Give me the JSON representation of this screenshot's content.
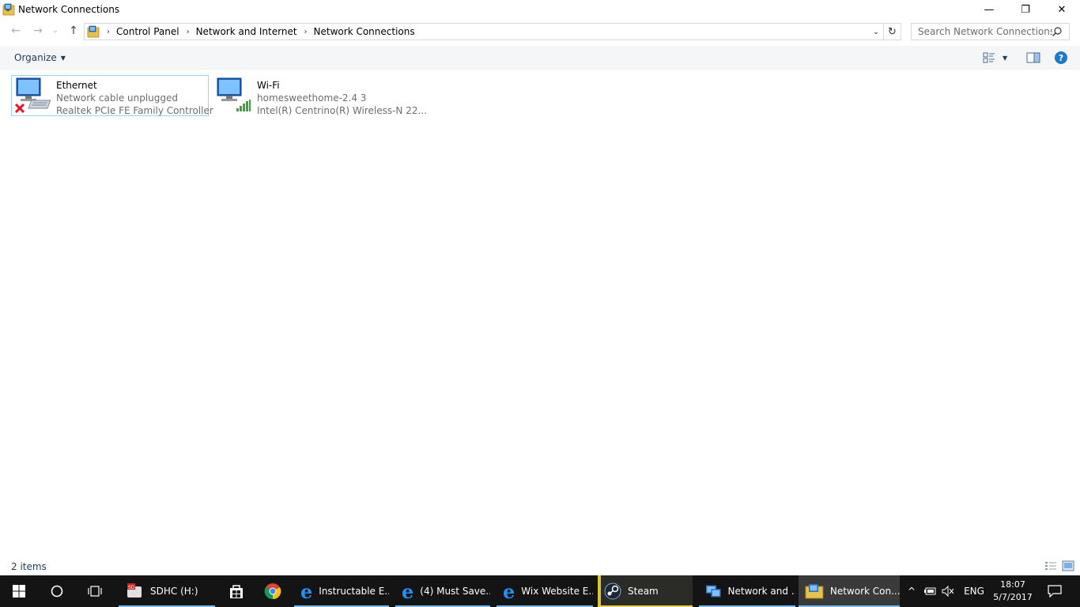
{
  "window": {
    "title": "Network Connections",
    "controls": {
      "minimize": "—",
      "maximize": "❐",
      "close": "✕"
    }
  },
  "nav": {
    "back": "←",
    "forward": "→",
    "recent": "⌄",
    "up": "↑",
    "breadcrumb": [
      "Control Panel",
      "Network and Internet",
      "Network Connections"
    ],
    "separator": "›",
    "dropdown": "⌄",
    "refresh": "↻"
  },
  "search": {
    "placeholder": "Search Network Connections"
  },
  "commandbar": {
    "organize_label": "Organize",
    "organize_arrow": "▼",
    "view_arrow": "▼",
    "help": "?"
  },
  "items": [
    {
      "name": "Ethernet",
      "status": "Network cable unplugged",
      "device": "Realtek PCIe FE Family Controller",
      "state": "disconnected",
      "status_color": "#e81123"
    },
    {
      "name": "Wi-Fi",
      "status": "homesweethome-2.4  3",
      "device": "Intel(R) Centrino(R) Wireless-N 22...",
      "state": "connected",
      "status_color": "#3aa837"
    }
  ],
  "statusbar": {
    "count": "2 items"
  },
  "taskbar": {
    "apps": [
      {
        "label": "SDHC (H:)",
        "icon": "sd-card-icon"
      },
      {
        "label": "",
        "icon": "store-icon"
      },
      {
        "label": "",
        "icon": "chrome-icon"
      },
      {
        "label": "Instructable E...",
        "icon": "edge-icon"
      },
      {
        "label": "(4) Must Save...",
        "icon": "edge-icon"
      },
      {
        "label": "Wix Website E...",
        "icon": "edge-icon"
      },
      {
        "label": "Steam",
        "icon": "steam-icon"
      },
      {
        "label": "Network and ...",
        "icon": "network-folder-icon"
      },
      {
        "label": "Network Con...",
        "icon": "network-folder-icon"
      }
    ],
    "tray": {
      "chevron": "^",
      "lang": "ENG"
    },
    "clock": {
      "time": "18:07",
      "date": "5/7/2017"
    }
  },
  "colors": {
    "accent": "#1979ca",
    "selection_border": "#99d1ff",
    "taskbar": "#141414",
    "taskbar_indicator": "#76b9ed"
  }
}
